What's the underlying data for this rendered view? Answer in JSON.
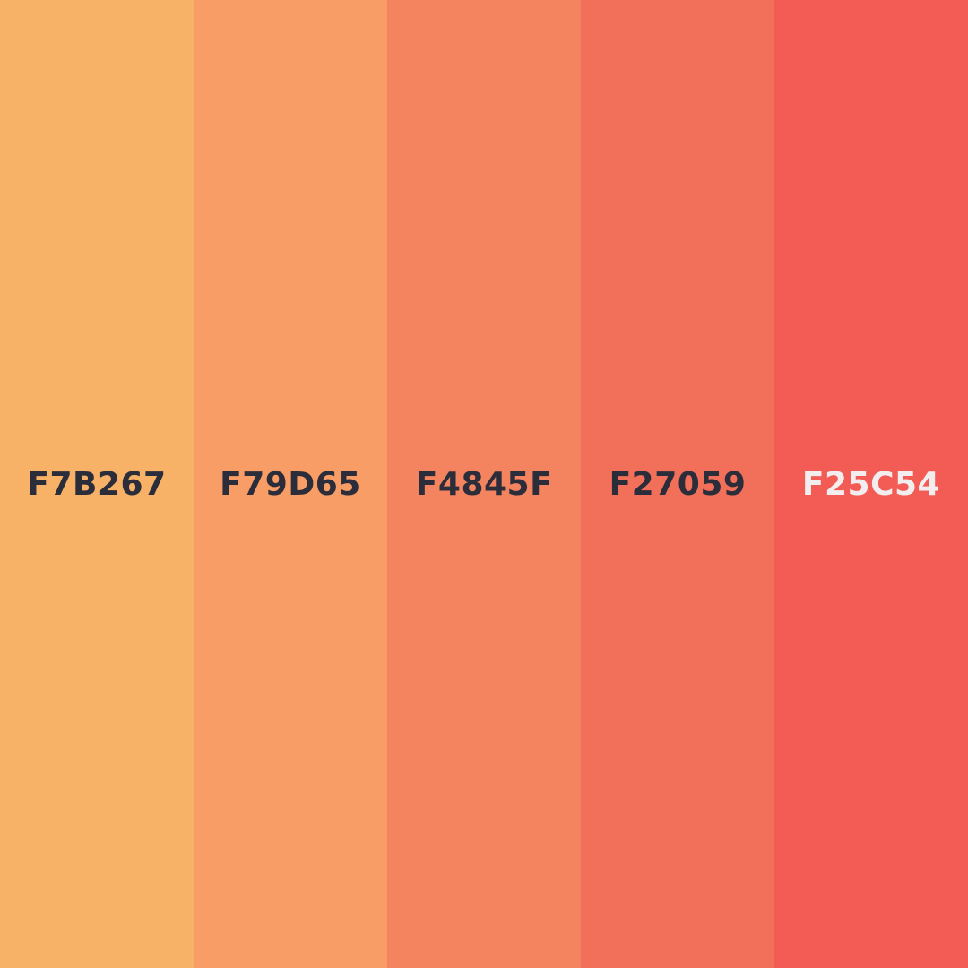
{
  "swatches": [
    {
      "label": "F7B267",
      "color": "#F7B267",
      "text_color": "#2B2D3A"
    },
    {
      "label": "F79D65",
      "color": "#F79D65",
      "text_color": "#2B2D3A"
    },
    {
      "label": "F4845F",
      "color": "#F4845F",
      "text_color": "#2B2D3A"
    },
    {
      "label": "F27059",
      "color": "#F27059",
      "text_color": "#2B2D3A"
    },
    {
      "label": "F25C54",
      "color": "#F25C54",
      "text_color": "#F2EEF0"
    }
  ]
}
